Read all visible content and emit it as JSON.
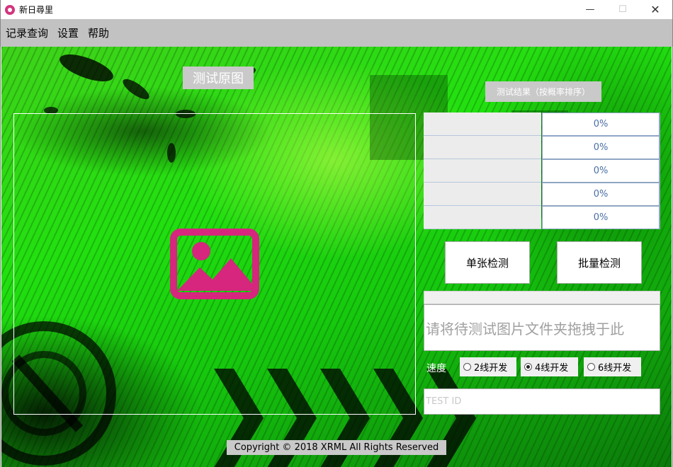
{
  "window": {
    "title": "新日尋里",
    "minimize_glyph": "—",
    "maximize_glyph": "☐",
    "close_glyph": "✕",
    "app_icon": "camera-icon"
  },
  "menu": {
    "items": [
      {
        "label": "记录查询"
      },
      {
        "label": "设置"
      },
      {
        "label": "帮助"
      }
    ]
  },
  "preview": {
    "title": "测试原图",
    "placeholder_icon": "image-placeholder-icon",
    "icon_color": "#d6267d"
  },
  "results": {
    "title": "测试结果（按概率排序）",
    "rows": [
      {
        "label": "",
        "value": "0%"
      },
      {
        "label": "",
        "value": "0%"
      },
      {
        "label": "",
        "value": "0%"
      },
      {
        "label": "",
        "value": "0%"
      },
      {
        "label": "",
        "value": "0%"
      }
    ]
  },
  "actions": {
    "single_label": "单张检测",
    "batch_label": "批量检测"
  },
  "drop_zone": {
    "hint": "请将待测试图片文件夹拖拽于此"
  },
  "speed": {
    "label": "速度",
    "options": [
      {
        "label": "2线开发",
        "checked": false
      },
      {
        "label": "4线开发",
        "checked": true
      },
      {
        "label": "6线开发",
        "checked": false
      }
    ]
  },
  "test_id": {
    "placeholder": "TEST ID",
    "value": ""
  },
  "footer": {
    "copyright": "Copyright © 2018 XRML All Rights Reserved"
  },
  "colors": {
    "background_green": "#22e010",
    "menubar": "#c2c2c2",
    "label_box": "#c9c9c9",
    "result_value_text": "#4a6fa5"
  }
}
